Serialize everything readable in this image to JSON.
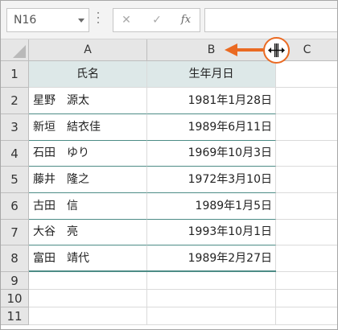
{
  "formula_bar": {
    "name_box_value": "N16",
    "cancel_icon": "close-icon",
    "enter_icon": "check-icon",
    "function_label": "fx",
    "formula_value": ""
  },
  "columns": [
    "A",
    "B",
    "C"
  ],
  "rows": [
    "1",
    "2",
    "3",
    "4",
    "5",
    "6",
    "7",
    "8",
    "9",
    "10",
    "11"
  ],
  "table": {
    "headers": [
      "氏名",
      "生年月日"
    ],
    "data": [
      [
        "星野　源太",
        "1981年1月28日"
      ],
      [
        "新垣　結衣佳",
        "1989年6月11日"
      ],
      [
        "石田　ゆり",
        "1969年10月3日"
      ],
      [
        "藤井　隆之",
        "1972年3月10日"
      ],
      [
        "古田　信",
        "1989年1月5日"
      ],
      [
        "大谷　亮",
        "1993年10月1日"
      ],
      [
        "富田　靖代",
        "1989年2月27日"
      ]
    ]
  },
  "colors": {
    "header_fill": "#dde8e8",
    "table_border": "#4d8c86",
    "annotation": "#ea6a22"
  },
  "annotation": {
    "cursor_icon": "column-resize-cursor-icon",
    "arrow_icon": "left-arrow-icon"
  }
}
